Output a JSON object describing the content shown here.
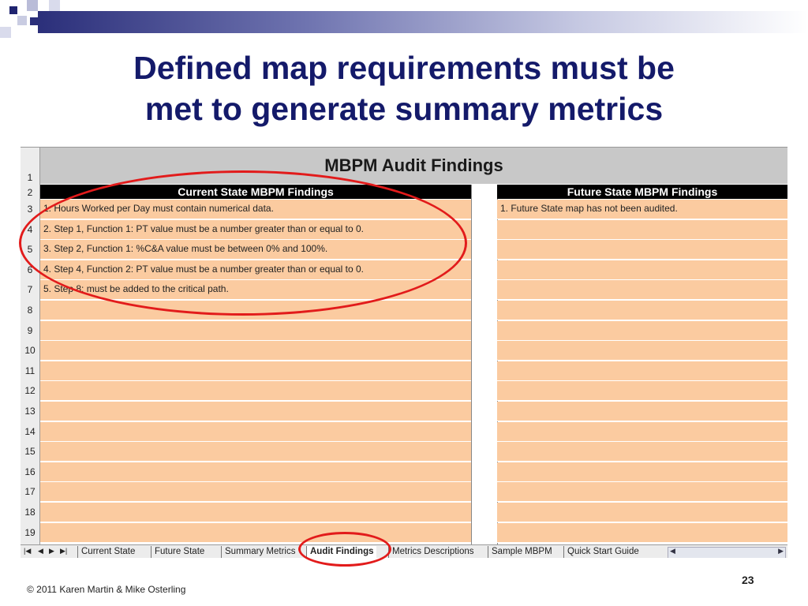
{
  "slide": {
    "title_line1": "Defined map requirements must be",
    "title_line2": "met to generate summary metrics",
    "footer": "© 2011 Karen Martin & Mike Osterling",
    "page_number": "23"
  },
  "sheet": {
    "title": "MBPM Audit Findings",
    "left_header": "Current State MBPM Findings",
    "right_header": "Future State MBPM Findings",
    "row_numbers": [
      "1",
      "2",
      "3",
      "4",
      "5",
      "6",
      "7",
      "8",
      "9",
      "10",
      "11",
      "12",
      "13",
      "14",
      "15",
      "16",
      "17",
      "18",
      "19"
    ],
    "current_findings": [
      "1. Hours Worked per Day must contain numerical data.",
      "2. Step 1, Function 1: PT value must be a number greater than or equal to 0.",
      "3. Step 2, Function 1: %C&A value must be between 0% and 100%.",
      "4. Step 4, Function 2: PT value must be a number greater than or equal to 0.",
      "5. Step 8: must be added to the critical path."
    ],
    "future_findings": [
      "1. Future State map has not been audited."
    ],
    "tabs": [
      "Current State",
      "Future State",
      "Summary Metrics",
      "Audit Findings",
      "Metrics Descriptions",
      "Sample MBPM",
      "Quick Start Guide"
    ],
    "active_tab": "Audit Findings",
    "nav_icons": [
      "first-sheet-icon",
      "prev-sheet-icon",
      "next-sheet-icon",
      "last-sheet-icon"
    ]
  },
  "colors": {
    "title": "#141a6a",
    "cell_fill": "#fbcba0",
    "highlight_oval": "#e21b1b",
    "header_bar": "#000000"
  }
}
